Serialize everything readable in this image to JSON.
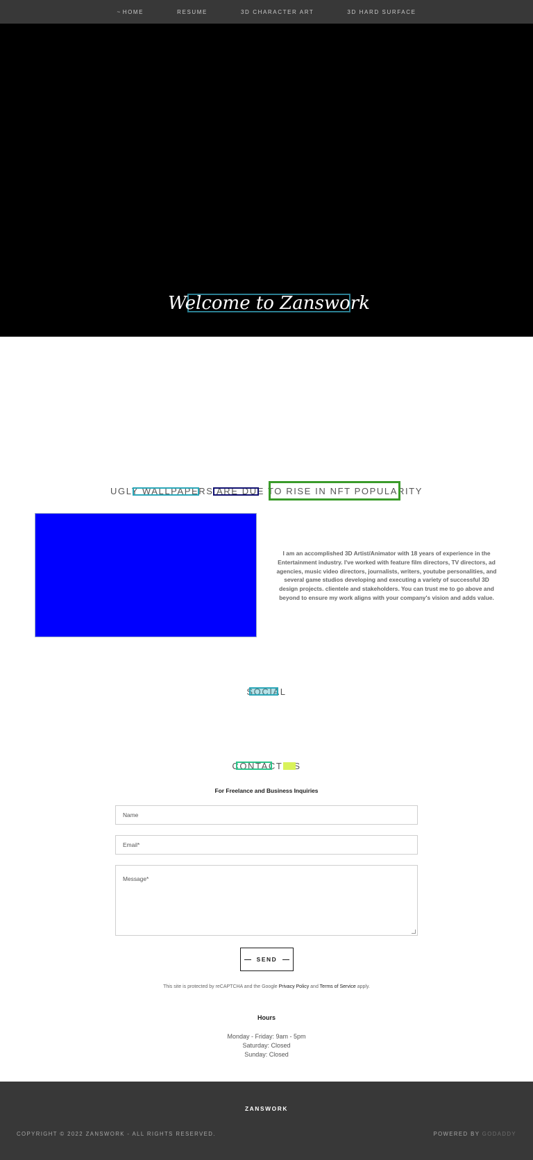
{
  "nav": {
    "items": [
      {
        "label": "HOME",
        "active": true,
        "marker": "~"
      },
      {
        "label": "RESUME"
      },
      {
        "label": "3D CHARACTER ART"
      },
      {
        "label": "3D HARD SURFACE"
      }
    ]
  },
  "hero": {
    "title": "Welcome to Zanswork",
    "background": "#000000",
    "title_box_color": "#2b7f92"
  },
  "about": {
    "heading": "UGLY WALLPAPERS ARE DUE TO RISE IN NFT POPULARITY",
    "image_color": "#0000ff",
    "text": "I am an accomplished 3D Artist/Animator with 18 years of experience in the Entertainment industry. I've worked with feature film directors, TV directors, ad agencies, music video directors, journalists, writers, youtube personalities, and several game studios developing and executing a variety of successful 3D design projects. clientele and stakeholders. You can trust me to go above and beyond to ensure my work aligns with your company's vision and adds value."
  },
  "social": {
    "heading": "SOCIAL"
  },
  "contact": {
    "heading": "CONTACT US",
    "subtitle": "For Freelance and Business Inquiries",
    "name_placeholder": "Name",
    "email_placeholder": "Email*",
    "message_placeholder": "Message*",
    "send_label": "SEND",
    "recaptcha": {
      "prefix": "This site is protected by reCAPTCHA and the Google",
      "privacy_label": "Privacy Policy",
      "and": "and",
      "terms_label": "Terms of Service",
      "suffix": "apply."
    }
  },
  "hours": {
    "title": "Hours",
    "lines": [
      "Monday - Friday: 9am - 5pm",
      "Saturday: Closed",
      "Sunday: Closed"
    ]
  },
  "footer": {
    "brand": "ZANSWORK",
    "copyright": "COPYRIGHT © 2022 ZANSWORK - ALL RIGHTS RESERVED.",
    "powered_by": "POWERED BY",
    "powered_link": "GODADDY"
  },
  "colors": {
    "nav_bg": "#383838",
    "footer_bg": "#383838",
    "overlay_teal": "#2aa7b8",
    "overlay_navy": "#101070",
    "overlay_green": "#3a9b2a",
    "overlay_green2": "#2bc48a",
    "overlay_yellow": "#d9f25a"
  }
}
